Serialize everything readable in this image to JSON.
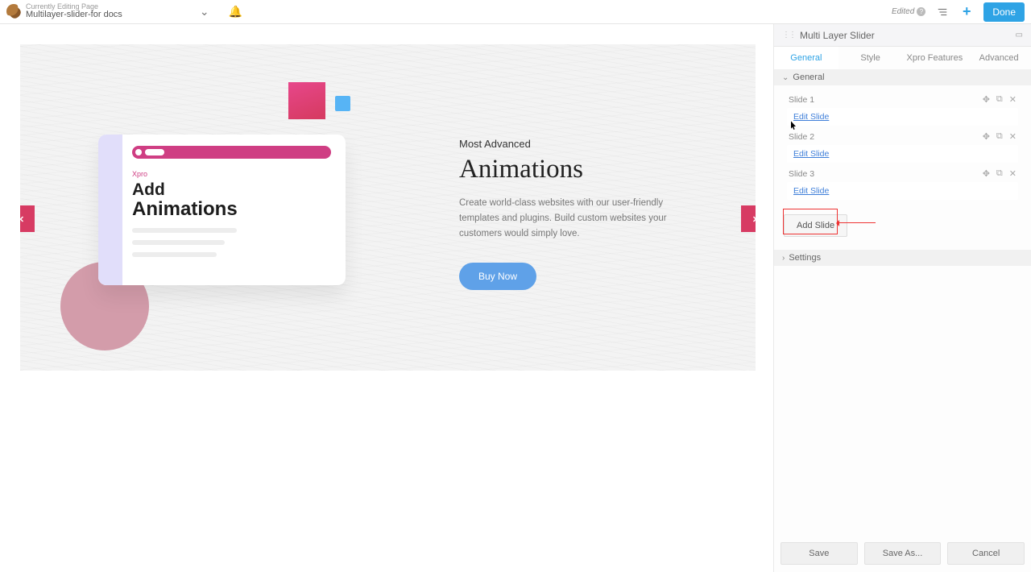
{
  "header": {
    "editing_label": "Currently Editing Page",
    "page_title": "Multilayer-slider-for docs",
    "edited_label": "Edited",
    "done": "Done"
  },
  "slider": {
    "overline": "Most Advanced",
    "headline": "Animations",
    "paragraph": "Create world-class websites with our user-friendly templates and plugins. Build custom websites your customers would simply love.",
    "cta": "Buy Now",
    "card_label": "Xpro",
    "card_add": "Add",
    "card_animations": "Animations"
  },
  "panel": {
    "title": "Multi Layer Slider",
    "tabs": [
      "General",
      "Style",
      "Xpro Features",
      "Advanced"
    ],
    "sections": {
      "general": "General",
      "settings": "Settings"
    },
    "slides": [
      {
        "name": "Slide 1",
        "edit": "Edit Slide"
      },
      {
        "name": "Slide 2",
        "edit": "Edit Slide"
      },
      {
        "name": "Slide 3",
        "edit": "Edit Slide"
      }
    ],
    "add_slide": "Add Slide",
    "footer": {
      "save": "Save",
      "save_as": "Save As...",
      "cancel": "Cancel"
    }
  }
}
